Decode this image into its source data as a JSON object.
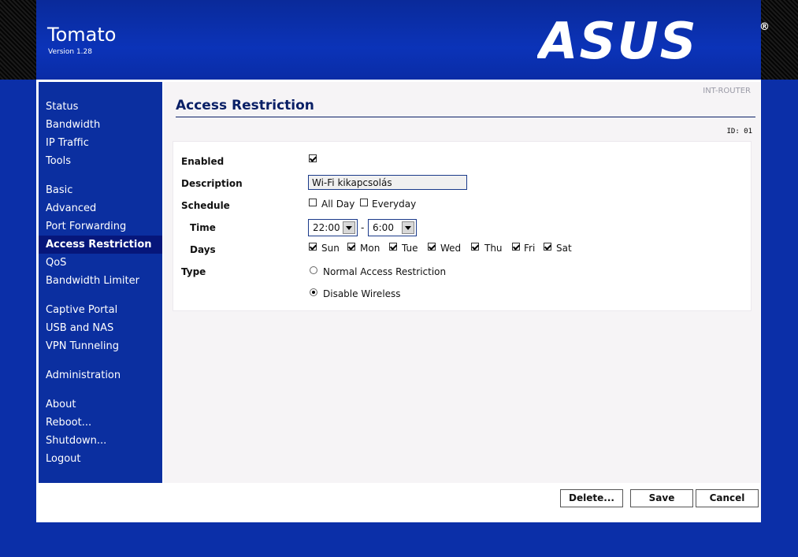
{
  "header": {
    "app_title": "Tomato",
    "app_version": "Version 1.28",
    "logo_text": "ASUS",
    "logo_mark": "®"
  },
  "sidebar": {
    "items": [
      {
        "label": "Status"
      },
      {
        "label": "Bandwidth"
      },
      {
        "label": "IP Traffic"
      },
      {
        "label": "Tools"
      },
      {
        "label": "Basic"
      },
      {
        "label": "Advanced"
      },
      {
        "label": "Port Forwarding"
      },
      {
        "label": "Access Restriction"
      },
      {
        "label": "QoS"
      },
      {
        "label": "Bandwidth Limiter"
      },
      {
        "label": "Captive Portal"
      },
      {
        "label": "USB and NAS"
      },
      {
        "label": "VPN Tunneling"
      },
      {
        "label": "Administration"
      },
      {
        "label": "About"
      },
      {
        "label": "Reboot..."
      },
      {
        "label": "Shutdown..."
      },
      {
        "label": "Logout"
      }
    ],
    "active": "Access Restriction"
  },
  "main": {
    "router_name": "INT-ROUTER",
    "title": "Access Restriction",
    "id_label": "ID: 01",
    "form": {
      "enabled_label": "Enabled",
      "enabled_checked": true,
      "description_label": "Description",
      "description_value": "Wi-Fi kikapcsolás",
      "schedule_label": "Schedule",
      "all_day_label": "All Day",
      "all_day_checked": false,
      "everyday_label": "Everyday",
      "everyday_checked": false,
      "time_label": "Time",
      "time_start": "22:00",
      "time_separator": "-",
      "time_end": "6:00",
      "days_label": "Days",
      "days": [
        {
          "label": "Sun",
          "checked": true
        },
        {
          "label": "Mon",
          "checked": true
        },
        {
          "label": "Tue",
          "checked": true
        },
        {
          "label": "Wed",
          "checked": true
        },
        {
          "label": "Thu",
          "checked": true
        },
        {
          "label": "Fri",
          "checked": true
        },
        {
          "label": "Sat",
          "checked": true
        }
      ],
      "type_label": "Type",
      "type_options": [
        {
          "label": "Normal Access Restriction",
          "selected": false
        },
        {
          "label": "Disable Wireless",
          "selected": true
        }
      ]
    }
  },
  "footer": {
    "delete_label": "Delete...",
    "save_label": "Save",
    "cancel_label": "Cancel"
  }
}
